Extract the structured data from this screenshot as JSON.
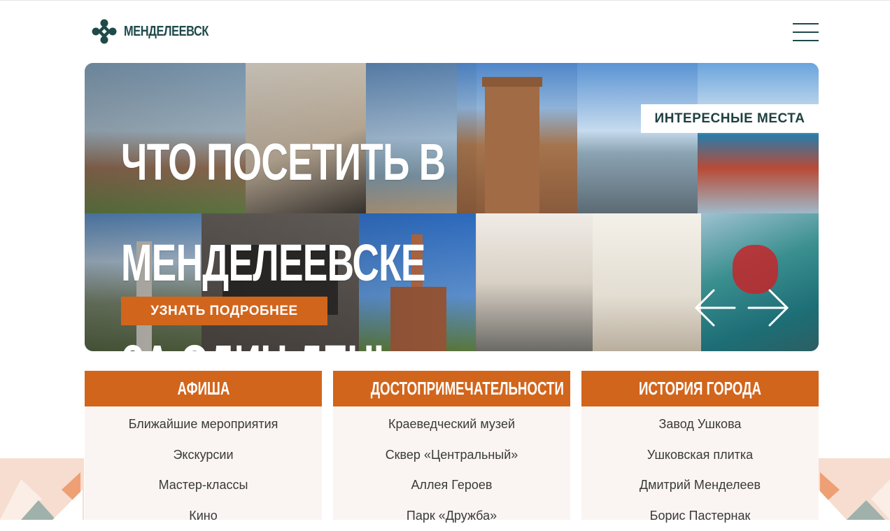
{
  "header": {
    "logo_text": "МЕНДЕЛЕЕВСК",
    "logo_icon": "ornament-flower-icon",
    "menu_icon": "hamburger-menu-icon"
  },
  "hero": {
    "title_lines": [
      "ЧТО ПОСЕТИТЬ В",
      "МЕНДЕЛЕЕВСКЕ",
      "ЗА ОДИН ДЕНЬ"
    ],
    "badge": "ИНТЕРЕСНЫЕ МЕСТА",
    "button_label": "УЗНАТЬ ПОДРОБНЕЕ",
    "prev_icon": "arrow-left-icon",
    "next_icon": "arrow-right-icon"
  },
  "cards": [
    {
      "title": "АФИША",
      "items": [
        "Ближайшие мероприятия",
        "Экскурсии",
        "Мастер-классы",
        "Кино"
      ]
    },
    {
      "title": "ДОСТОПРИМЕЧАТЕЛЬНОСТИ",
      "items": [
        "Краеведческий музей",
        "Сквер «Центральный»",
        "Аллея Героев",
        "Парк «Дружба»"
      ]
    },
    {
      "title": "ИСТОРИЯ ГОРОДА",
      "items": [
        "Завод Ушкова",
        "Ушковская плитка",
        "Дмитрий Менделеев",
        "Борис Пастернак"
      ]
    }
  ],
  "colors": {
    "accent": "#d2651c",
    "brand_dark": "#1f4a4a",
    "card_bg": "#faf5f2"
  }
}
